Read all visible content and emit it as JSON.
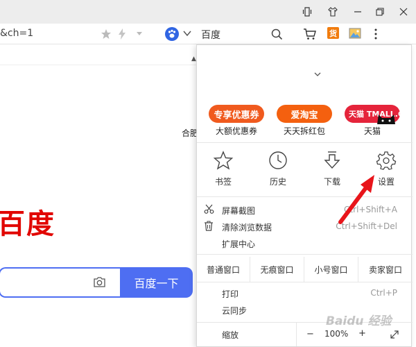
{
  "address": {
    "text": "&ch=1"
  },
  "search_engine": {
    "label": "百度"
  },
  "page": {
    "city_partial": "合肥",
    "logo_text": "百度",
    "search_button": "百度一下"
  },
  "menu": {
    "promos": [
      {
        "badge": "专享优惠券",
        "label": "大额优惠券",
        "color": "#f2561f"
      },
      {
        "badge": "爱淘宝",
        "label": "天天拆红包",
        "color": "#f45b0e"
      },
      {
        "badge": "天猫 TMALL.COM",
        "label": "天猫",
        "color": "#e5243b"
      }
    ],
    "tools": [
      {
        "icon": "star-outline-icon",
        "label": "书签"
      },
      {
        "icon": "clock-icon",
        "label": "历史"
      },
      {
        "icon": "download-icon",
        "label": "下载"
      },
      {
        "icon": "gear-icon",
        "label": "设置"
      }
    ],
    "items": [
      {
        "icon": "scissors-icon",
        "label": "屏幕截图",
        "shortcut": "Ctrl+Shift+A"
      },
      {
        "icon": "trash-icon",
        "label": "清除浏览数据",
        "shortcut": "Ctrl+Shift+Del"
      },
      {
        "icon": "",
        "label": "扩展中心",
        "shortcut": ""
      }
    ],
    "windows": [
      "普通窗口",
      "无痕窗口",
      "小号窗口",
      "卖家窗口"
    ],
    "items2": [
      {
        "label": "打印",
        "shortcut": "Ctrl+P"
      },
      {
        "label": "云同步",
        "shortcut": ""
      }
    ],
    "zoom": {
      "label": "缩放",
      "minus": "−",
      "value": "100%",
      "plus": "+"
    }
  },
  "watermark": "Baidu 经验"
}
